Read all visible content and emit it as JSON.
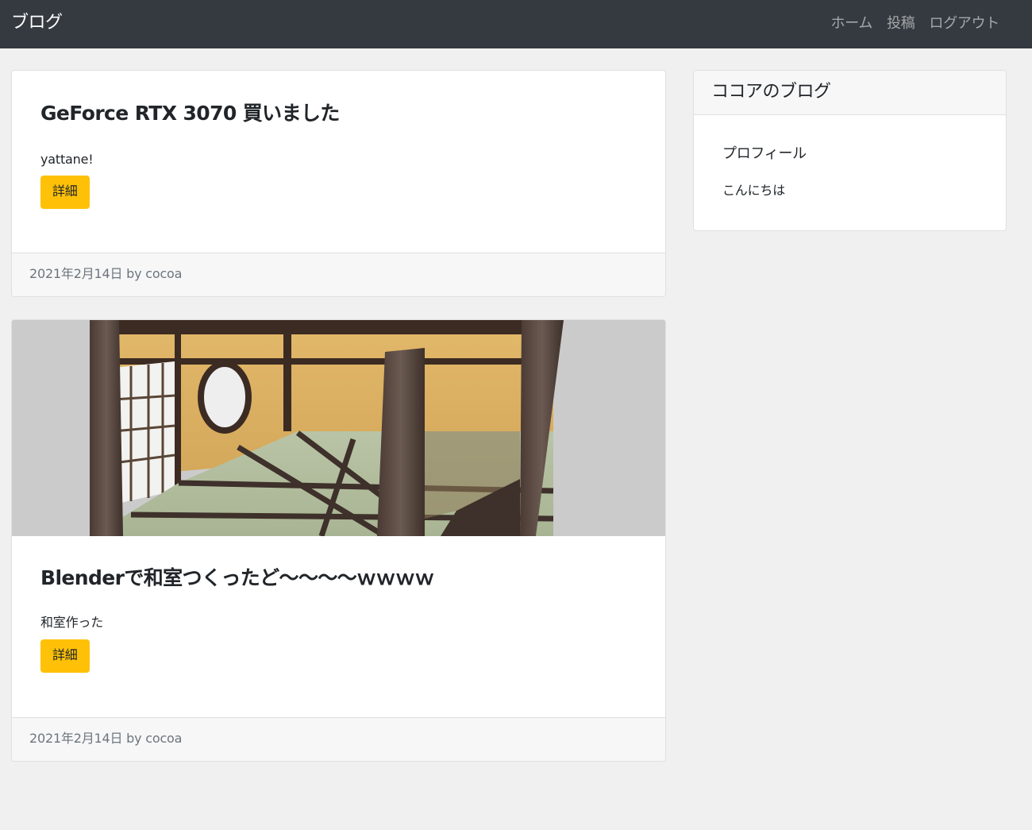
{
  "navbar": {
    "brand": "ブログ",
    "links": [
      "ホーム",
      "投稿",
      "ログアウト"
    ]
  },
  "posts": [
    {
      "title": "GeForce RTX 3070 買いました",
      "excerpt": "yattane!",
      "button_label": "詳細",
      "footer": "2021年2月14日 by cocoa"
    },
    {
      "image": "washitsu-render",
      "title": "Blenderで和室つくったど～～～～ｗｗｗｗ",
      "excerpt": "和室作った",
      "button_label": "詳細",
      "footer": "2021年2月14日 by cocoa"
    }
  ],
  "sidebar": {
    "title": "ココアのブログ",
    "link": "プロフィール",
    "text": "こんにちは"
  },
  "colors": {
    "navbar_bg": "#343a40",
    "button_bg": "#ffc107",
    "page_bg": "#f0f0f0"
  }
}
